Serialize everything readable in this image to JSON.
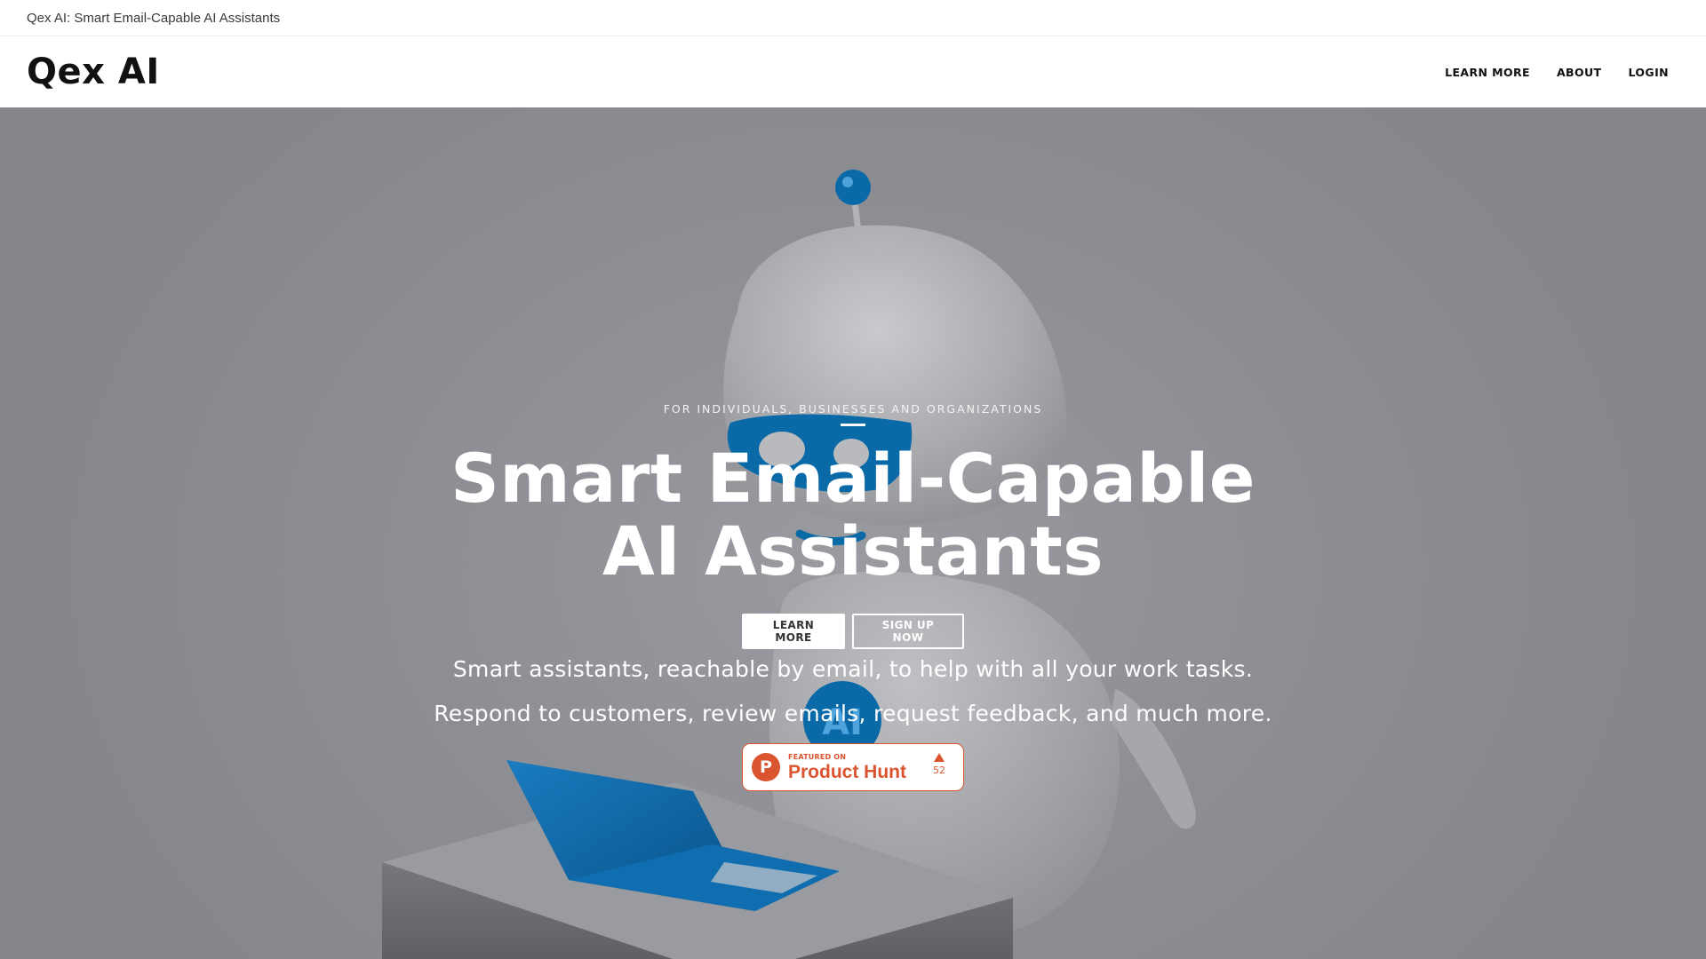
{
  "topbar": {
    "title": "Qex AI: Smart Email-Capable AI Assistants"
  },
  "header": {
    "logo": "Qex AI",
    "nav": [
      {
        "label": "LEARN MORE"
      },
      {
        "label": "ABOUT"
      },
      {
        "label": "LOGIN"
      }
    ]
  },
  "hero": {
    "eyebrow": "FOR INDIVIDUALS, BUSINESSES AND ORGANIZATIONS",
    "headline_line1": "Smart Email-Capable",
    "headline_line2": "AI Assistants",
    "buttons": {
      "learn_more": "LEARN MORE",
      "sign_up": "SIGN UP NOW"
    },
    "sub1": "Smart assistants, reachable by email, to help with all your work tasks.",
    "sub2": "Respond to customers, review emails, request feedback, and much more.",
    "badge": {
      "logo_letter": "P",
      "small": "FEATURED ON",
      "big": "Product Hunt",
      "votes": "52"
    }
  },
  "colors": {
    "brand_orange": "#da552f",
    "hero_overlay": "#8d8e93",
    "robot_blue": "#0a6aa8"
  }
}
